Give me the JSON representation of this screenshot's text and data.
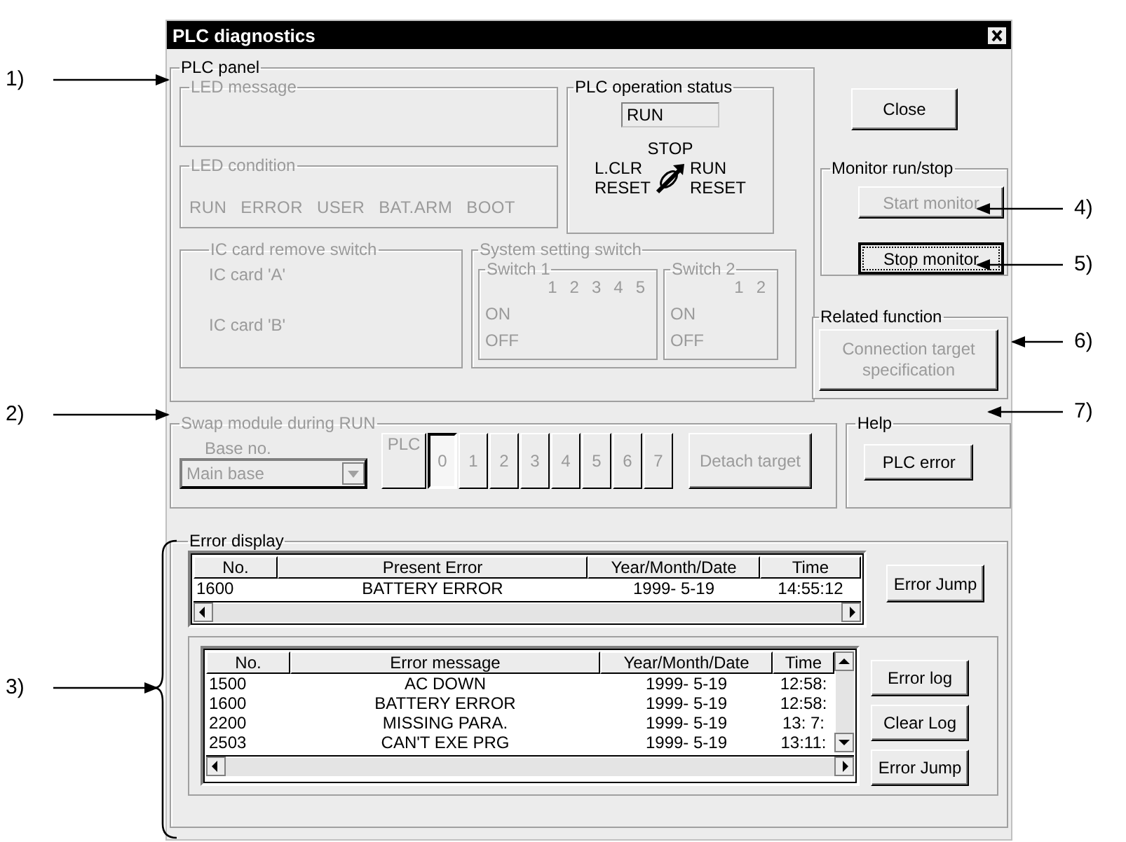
{
  "window": {
    "title": "PLC diagnostics"
  },
  "plc_panel": {
    "title": "PLC panel",
    "disabled": false,
    "led_message": {
      "title": "LED message",
      "disabled": true
    },
    "led_condition": {
      "title": "LED condition",
      "disabled": true,
      "labels": [
        "RUN",
        "ERROR",
        "USER",
        "BAT.ARM",
        "BOOT"
      ]
    },
    "operation_status": {
      "title": "PLC operation status",
      "disabled": false,
      "value": "RUN",
      "stop": "STOP",
      "left": [
        "L.CLR",
        "RESET"
      ],
      "right": [
        "RUN",
        "RESET"
      ]
    },
    "ic_card": {
      "title": "IC card remove switch",
      "disabled": true,
      "cards": [
        "IC card 'A'",
        "IC card 'B'"
      ]
    },
    "system_setting": {
      "title": "System setting switch",
      "disabled": true,
      "switches": [
        {
          "title": "Switch 1",
          "numbers": [
            "1",
            "2",
            "3",
            "4",
            "5"
          ],
          "on": "ON",
          "off": "OFF"
        },
        {
          "title": "Switch 2",
          "numbers": [
            "1",
            "2"
          ],
          "on": "ON",
          "off": "OFF"
        }
      ]
    }
  },
  "swap_module": {
    "title": "Swap module during RUN",
    "disabled": true,
    "base_label": "Base no.",
    "base_value": "Main base",
    "slots": [
      {
        "label": "PLC",
        "selected": false
      },
      {
        "label": "0",
        "selected": true
      },
      {
        "label": "1",
        "selected": false
      },
      {
        "label": "2",
        "selected": false
      },
      {
        "label": "3",
        "selected": false
      },
      {
        "label": "4",
        "selected": false
      },
      {
        "label": "5",
        "selected": false
      },
      {
        "label": "6",
        "selected": false
      },
      {
        "label": "7",
        "selected": false
      }
    ],
    "detach": "Detach target"
  },
  "close_button": "Close",
  "monitor": {
    "title": "Monitor run/stop",
    "buttons": [
      {
        "label": "Start monitor",
        "disabled": true,
        "focused": false
      },
      {
        "label": "Stop monitor",
        "disabled": false,
        "focused": true
      }
    ]
  },
  "related": {
    "title": "Related function",
    "button": {
      "label": "Connection target specification",
      "disabled": true
    }
  },
  "help": {
    "title": "Help",
    "button": "PLC error"
  },
  "error_display": {
    "title": "Error display",
    "present": {
      "columns": [
        "No.",
        "Present Error",
        "Year/Month/Date",
        "Time"
      ],
      "rows": [
        [
          "1600",
          "BATTERY ERROR",
          "1999- 5-19",
          "14:55:12"
        ]
      ],
      "button": "Error Jump"
    },
    "log": {
      "columns": [
        "No.",
        "Error message",
        "Year/Month/Date",
        "Time"
      ],
      "rows": [
        [
          "1500",
          "AC DOWN",
          "1999- 5-19",
          "12:58:"
        ],
        [
          "1600",
          "BATTERY ERROR",
          "1999- 5-19",
          "12:58:"
        ],
        [
          "2200",
          "MISSING PARA.",
          "1999- 5-19",
          "13: 7:"
        ],
        [
          "2503",
          "CAN'T EXE PRG",
          "1999- 5-19",
          "13:11:"
        ]
      ],
      "buttons": [
        "Error log",
        "Clear Log",
        "Error Jump"
      ]
    }
  },
  "callouts": [
    {
      "label": "1)"
    },
    {
      "label": "2)"
    },
    {
      "label": "3)"
    },
    {
      "label": "4)"
    },
    {
      "label": "5)"
    },
    {
      "label": "6)"
    },
    {
      "label": "7)"
    }
  ]
}
